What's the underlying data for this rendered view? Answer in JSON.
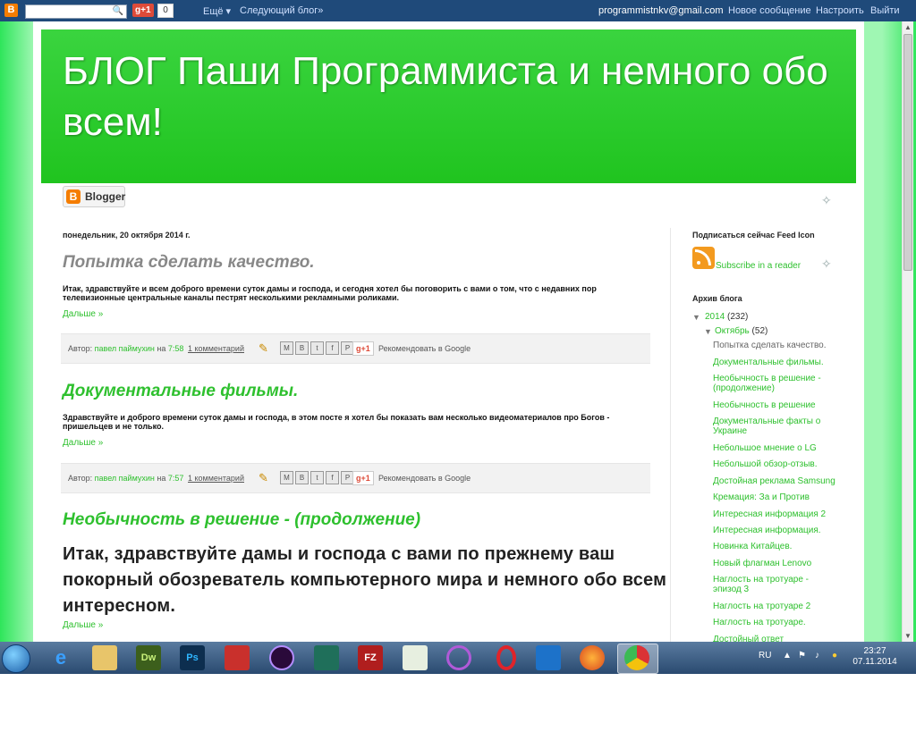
{
  "navbar": {
    "blogger_logo": "B",
    "gplus_label": "g+1",
    "gplus_count": "0",
    "more_label": "Ещё ▾",
    "next_blog": "Следующий блог»",
    "email": "programmistnkv@gmail.com",
    "new_post": "Новое сообщение",
    "customize": "Настроить",
    "logout": "Выйти"
  },
  "header": {
    "title": "БЛОГ Паши Программиста и немного обо всем!"
  },
  "badge": {
    "label": "Blogger",
    "letter": "B"
  },
  "main": {
    "date": "понедельник, 20 октября 2014 г.",
    "posts": [
      {
        "title": "Попытка сделать качество.",
        "title_color": "#888888",
        "body": "Итак, здравствуйте и всем доброго времени суток дамы и господа, и сегодня хотел бы поговорить с вами о том, что с недавних пор телевизионные центральные каналы пестрят несколькими рекламными роликами.",
        "more": "Дальше »",
        "author_prefix": "Автор:",
        "author": "павел паймухин",
        "at": "на",
        "time": "7:58",
        "comments": "1 комментарий",
        "recommend": "Рекомендовать в Google"
      },
      {
        "title": "Документальные фильмы.",
        "title_color": "#2ec02e",
        "body": "Здравствуйте и доброго времени суток дамы и господа, в этом посте я хотел бы показать вам несколько видеоматериалов про Богов - пришельцев и не только.",
        "more": "Дальше »",
        "author_prefix": "Автор:",
        "author": "павел паймухин",
        "at": "на",
        "time": "7:57",
        "comments": "1 комментарий",
        "recommend": "Рекомендовать в Google"
      },
      {
        "title": "Необычность в решение - (продолжение)",
        "title_color": "#2ec02e",
        "body": "Итак, здравствуйте дамы и господа с вами по прежнему ваш покорный обозреватель компьютерного мира и немного обо всем интересном.",
        "more": "Дальше »"
      }
    ],
    "gplus_label": "g+1"
  },
  "sidebar": {
    "subscribe_heading": "Подписаться сейчас Feed Icon",
    "subscribe_link": "Subscribe in a reader",
    "archive_heading": "Архив блога",
    "year": "2014",
    "year_count": "(232)",
    "month": "Октябрь",
    "month_count": "(52)",
    "items": [
      "Попытка сделать качество.",
      "Документальные фильмы.",
      "Необычность в решение - (продолжение)",
      "Необычность в решение",
      "Документальные факты о Украине",
      "Небольшое мнение о LG",
      "Небольшой обзор-отзыв.",
      "Достойная реклама Samsung",
      "Кремация: За и Против",
      "Интересная информация 2",
      "Интересная информация.",
      "Новинка Китайцев.",
      "Новый флагман Lenovo",
      "Наглость на тротуаре - эпизод 3",
      "Наглость на тротуаре 2",
      "Наглость на тротуаре.",
      "Достойный ответ"
    ]
  },
  "taskbar": {
    "lang": "RU",
    "time": "23:27",
    "date": "07.11.2014",
    "apps": [
      "ie-icon",
      "explorer-icon",
      "dreamweaver-icon",
      "photoshop-icon",
      "pdf-icon",
      "media-icon",
      "filezilla-icon",
      "notepad-icon",
      "opera-icon",
      "maxthon-icon",
      "firefox-icon",
      "chrome-icon"
    ],
    "dw_label": "Dw",
    "ps_label": "Ps",
    "fz_label": "FZ"
  },
  "colors": {
    "accent": "#2ec02e",
    "header_bg": "#20c41f",
    "navbar": "#1f4a7a"
  }
}
